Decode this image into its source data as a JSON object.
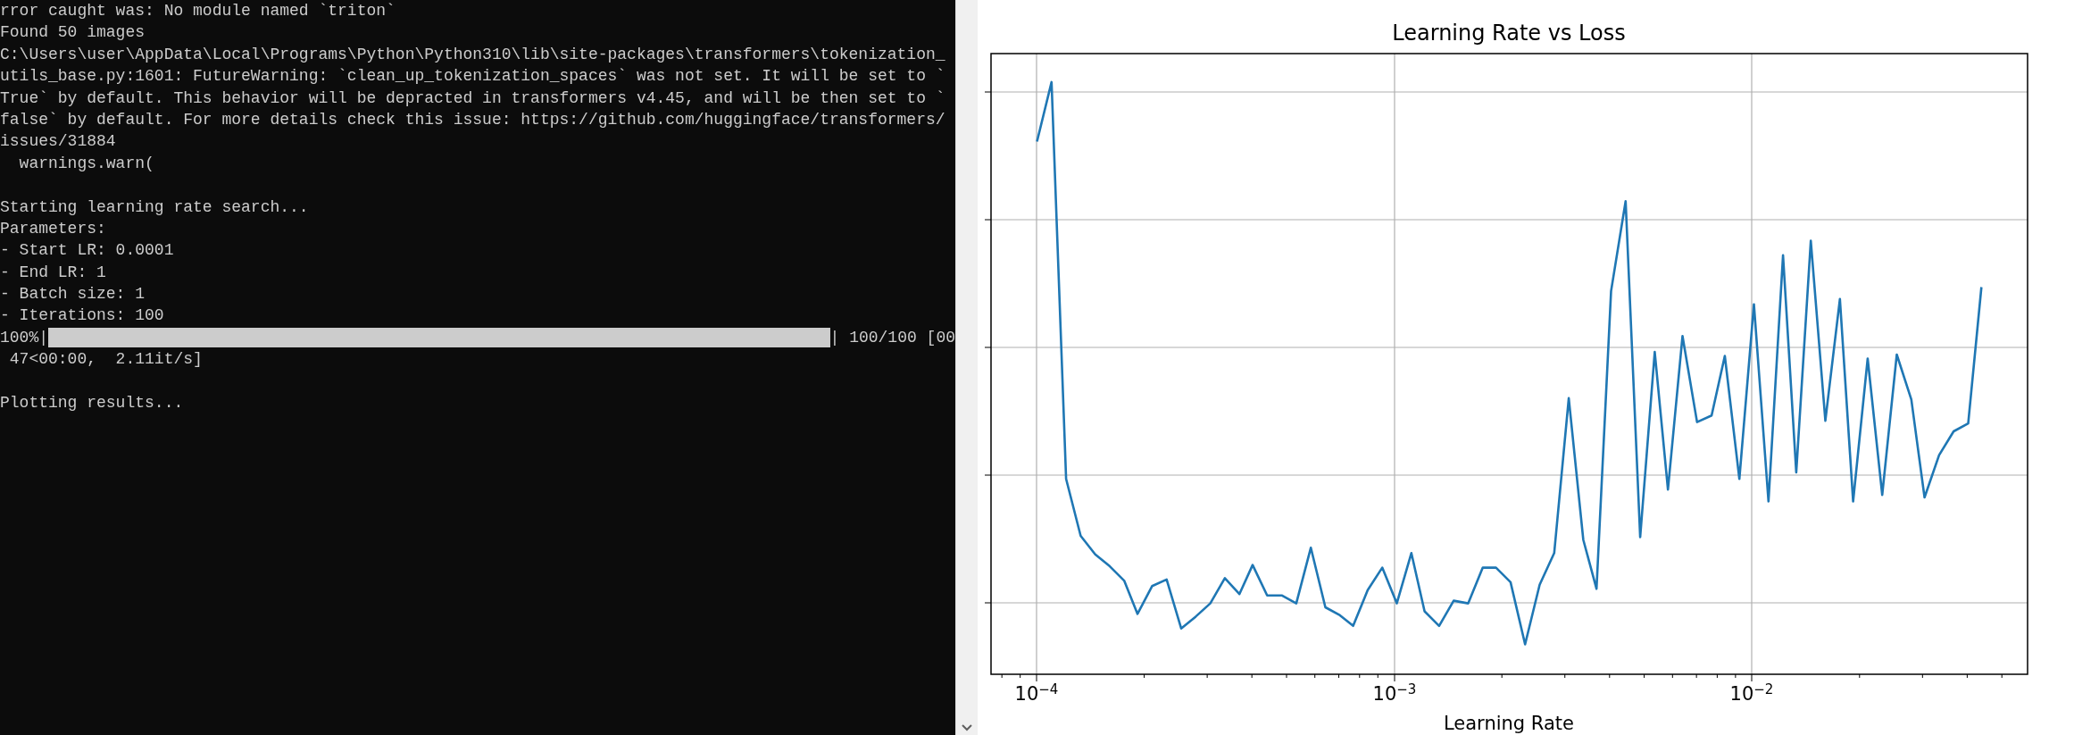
{
  "terminal": {
    "lines": [
      {
        "kind": "text",
        "text": "rror caught was: No module named `triton`"
      },
      {
        "kind": "text",
        "text": "Found 50 images"
      },
      {
        "kind": "text",
        "text": "C:\\Users\\user\\AppData\\Local\\Programs\\Python\\Python310\\lib\\site-packages\\transformers\\tokenization_"
      },
      {
        "kind": "text",
        "text": "utils_base.py:1601: FutureWarning: `clean_up_tokenization_spaces` was not set. It will be set to `"
      },
      {
        "kind": "text",
        "text": "True` by default. This behavior will be depracted in transformers v4.45, and will be then set to `"
      },
      {
        "kind": "text",
        "text": "false` by default. For more details check this issue: https://github.com/huggingface/transformers/"
      },
      {
        "kind": "text",
        "text": "issues/31884"
      },
      {
        "kind": "text",
        "text": "  warnings.warn("
      },
      {
        "kind": "blank"
      },
      {
        "kind": "text",
        "text": "Starting learning rate search..."
      },
      {
        "kind": "text",
        "text": "Parameters:"
      },
      {
        "kind": "text",
        "text": "- Start LR: 0.0001"
      },
      {
        "kind": "text",
        "text": "- End LR: 1"
      },
      {
        "kind": "text",
        "text": "- Batch size: 1"
      },
      {
        "kind": "text",
        "text": "- Iterations: 100"
      },
      {
        "kind": "progress",
        "prefix": "100%|",
        "level": 1,
        "suffix": "| 100/100 [00"
      },
      {
        "kind": "text",
        "text": " 47<00:00,  2.11it/s]"
      },
      {
        "kind": "blank"
      },
      {
        "kind": "text",
        "text": "Plotting results..."
      }
    ]
  },
  "plot": {
    "title": "Learning Rate vs Loss",
    "xlabel": "Learning Rate",
    "xtick_labels": [
      "10$^{−4}$",
      "10$^{−3}$",
      "10$^{−2}$"
    ]
  }
}
